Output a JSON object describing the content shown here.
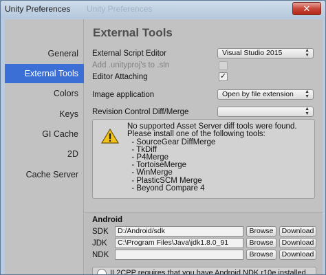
{
  "window": {
    "title": "Unity Preferences",
    "background_title": "Unity Preferences",
    "close_label": "✕"
  },
  "sidebar": {
    "items": [
      {
        "label": "General",
        "active": false
      },
      {
        "label": "External Tools",
        "active": true
      },
      {
        "label": "Colors",
        "active": false
      },
      {
        "label": "Keys",
        "active": false
      },
      {
        "label": "GI Cache",
        "active": false
      },
      {
        "label": "2D",
        "active": false
      },
      {
        "label": "Cache Server",
        "active": false
      }
    ]
  },
  "main": {
    "heading": "External Tools",
    "external_script_editor": {
      "label": "External Script Editor",
      "value": "Visual Studio 2015"
    },
    "add_unityproj": {
      "label": "Add .unityproj's to .sln",
      "checked": false,
      "enabled": false
    },
    "editor_attaching": {
      "label": "Editor Attaching",
      "checked": true
    },
    "image_application": {
      "label": "Image application",
      "value": "Open by file extension"
    },
    "revision_control": {
      "label": "Revision Control Diff/Merge",
      "value": ""
    },
    "warning": {
      "icon": "warning-icon",
      "lines": [
        "No supported Asset Server diff tools were found.",
        "Please install one of the following tools:",
        "  - SourceGear DiffMerge",
        "  - TkDiff",
        "  - P4Merge",
        "  - TortoiseMerge",
        "  - WinMerge",
        "  - PlasticSCM Merge",
        "  - Beyond Compare 4"
      ]
    }
  },
  "android": {
    "title": "Android",
    "rows": [
      {
        "label": "SDK",
        "path": "D:/Android/sdk",
        "browse": "Browse",
        "download": "Download"
      },
      {
        "label": "JDK",
        "path": "C:\\Program Files\\Java\\jdk1.8.0_91",
        "browse": "Browse",
        "download": "Download"
      },
      {
        "label": "NDK",
        "path": "",
        "browse": "Browse",
        "download": "Download"
      }
    ],
    "info_text": "IL2CPP requires that you have Android NDK r10e installed."
  },
  "colors": {
    "selection": "#3b6fd6",
    "panel": "#c2c2c2"
  }
}
